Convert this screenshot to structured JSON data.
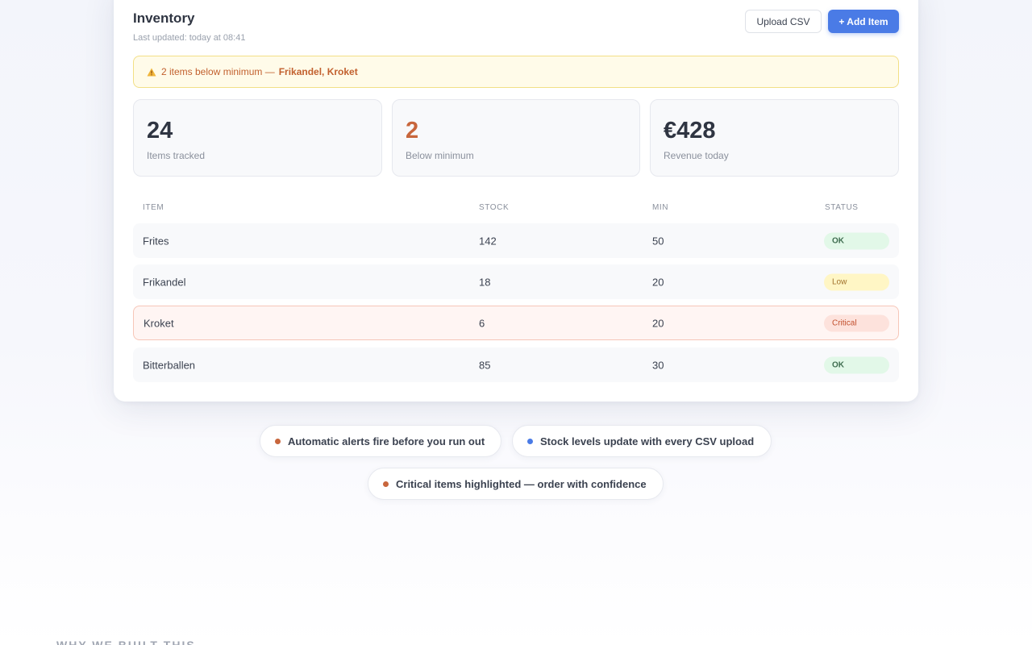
{
  "header": {
    "title": "Inventory",
    "last_updated": "Last updated: today at 08:41",
    "upload_label": "Upload CSV",
    "add_label": "+ Add Item"
  },
  "alert": {
    "text": "2 items below minimum —",
    "items": "Frikandel, Kroket",
    "icon": "warning-icon",
    "color": "#c2602e"
  },
  "stats": [
    {
      "value": "24",
      "label": "Items tracked"
    },
    {
      "value": "2",
      "label": "Below minimum"
    },
    {
      "value": "€428",
      "label": "Revenue today"
    }
  ],
  "table": {
    "headers": [
      "ITEM",
      "STOCK",
      "MIN",
      "STATUS"
    ],
    "rows": [
      {
        "item": "Frites",
        "stock": "142",
        "min": "50",
        "status": "OK"
      },
      {
        "item": "Frikandel",
        "stock": "18",
        "min": "20",
        "status": "Low"
      },
      {
        "item": "Kroket",
        "stock": "6",
        "min": "20",
        "status": "Critical"
      },
      {
        "item": "Bitterballen",
        "stock": "85",
        "min": "30",
        "status": "OK"
      }
    ]
  },
  "features": [
    {
      "text": "Automatic alerts fire before you run out",
      "dot_color": "#c8663c"
    },
    {
      "text": "Stock levels update with every CSV upload",
      "dot_color": "#4a7be6"
    },
    {
      "text": "Critical items highlighted — order with confidence",
      "dot_color": "#c8663c"
    }
  ],
  "next_section_heading": "WHY WE BUILT THIS",
  "colors": {
    "accent": "#4a7be6",
    "warning": "#c8663c",
    "ok_bg": "#e2f8e8",
    "low_bg": "#fff6c5",
    "critical_bg": "#fde2dc"
  }
}
